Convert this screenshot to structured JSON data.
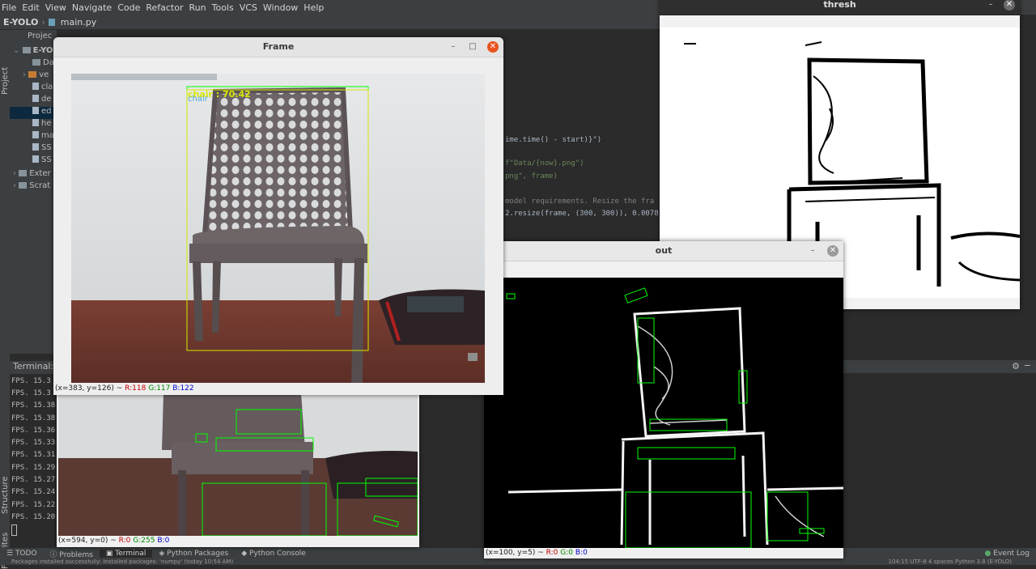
{
  "ide": {
    "menu": [
      "File",
      "Edit",
      "View",
      "Navigate",
      "Code",
      "Refactor",
      "Run",
      "Tools",
      "VCS",
      "Window",
      "Help"
    ],
    "project_name": "E-YOLO",
    "file_name": "main.py",
    "side_tabs": {
      "project": "Project",
      "structure": "Structure",
      "favorites": "Favorites"
    },
    "project_panel": {
      "header": "Projec",
      "root": "E-YO",
      "rows": [
        "Da",
        "ve",
        "cla",
        "de",
        "ed",
        "he",
        "ma",
        "SS",
        "SS",
        "Exter",
        "Scrat"
      ]
    },
    "editor_lines": [
      "ime.time() - start)}\")",
      "f\"Data/{now}.png\")",
      "png\", frame)",
      " model requirements. Resize the fra",
      "2.resize(frame, (300, 300)), 0.0078"
    ],
    "terminal": {
      "label": "Terminal:",
      "lines": [
        "FPS. 15.3",
        "FPS. 15.3",
        "FPS. 15.38",
        "FPS. 15.38",
        "FPS. 15.36",
        "FPS. 15.33",
        "FPS. 15.31",
        "FPS. 15.29",
        "FPS. 15.27",
        "FPS. 15.24",
        "FPS. 15.22",
        "FPS. 15.20"
      ]
    },
    "bottom_tabs": [
      "TODO",
      "Problems",
      "Terminal",
      "Python Packages",
      "Python Console"
    ],
    "active_tab": "Terminal",
    "event_log": "Event Log",
    "status": "Packages installed successfully: Installed packages: 'numpy' (today 10:54 AM)",
    "status_right": "104:15  UTF-8  4 spaces  Python 3.8 (E-YOLO)"
  },
  "windows": {
    "frame": {
      "title": "Frame",
      "detection_label": "chair : 70.42",
      "pixel_info": {
        "pos": "(x=383, y=126) ~",
        "r": "R:118",
        "g": "G:117",
        "b": "B:122"
      }
    },
    "thresh": {
      "title": "thresh"
    },
    "out": {
      "title": "out",
      "pixel_info": {
        "pos": "(x=100, y=5) ~",
        "r": "R:0",
        "g": "G:0",
        "b": "B:0"
      }
    },
    "back": {
      "pixel_info": {
        "pos": "(x=594, y=0) ~",
        "r": "R:0",
        "g": "G:255",
        "b": "B:0"
      }
    }
  },
  "colors": {
    "ide_bg": "#2b2b2b",
    "ide_panel": "#3c3f41",
    "close_orange": "#e95420",
    "detect_green": "#00ff00",
    "detect_yellow": "#ffff00"
  }
}
